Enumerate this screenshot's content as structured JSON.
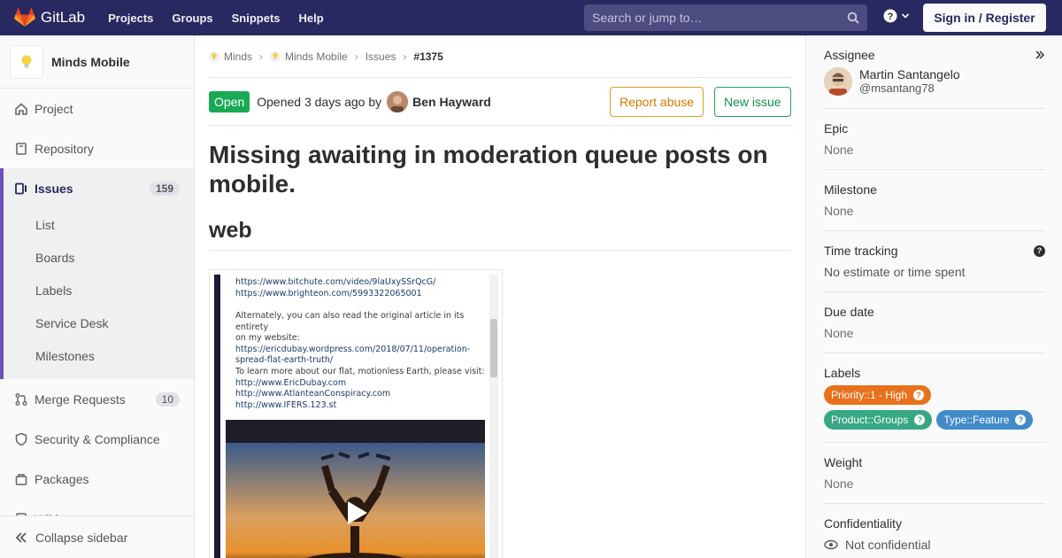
{
  "navbar": {
    "brand": "GitLab",
    "links": [
      "Projects",
      "Groups",
      "Snippets",
      "Help"
    ],
    "search_placeholder": "Search or jump to…",
    "signin": "Sign in / Register",
    "colors": {
      "bar": "#292961",
      "logo": "#fc6d26"
    }
  },
  "sidebar": {
    "project_name": "Minds Mobile",
    "items": {
      "project": "Project",
      "repository": "Repository",
      "issues": "Issues",
      "issues_count": "159",
      "merge_requests": "Merge Requests",
      "merge_requests_count": "10",
      "security": "Security & Compliance",
      "packages": "Packages",
      "wiki": "Wiki"
    },
    "sub_items": [
      "List",
      "Boards",
      "Labels",
      "Service Desk",
      "Milestones"
    ],
    "collapse": "Collapse sidebar"
  },
  "breadcrumb": [
    "Minds",
    "Minds Mobile",
    "Issues",
    "#1375"
  ],
  "issue": {
    "status": "Open",
    "opened_text": "Opened 3 days ago by",
    "author": "Ben Hayward",
    "report_abuse": "Report abuse",
    "new_issue": "New issue",
    "title": "Missing awaiting in moderation queue posts on mobile.",
    "heading": "web"
  },
  "screenshot_text": {
    "lines_top": [
      "https://www.bitchute.com/video/9laUxySSrQcG/",
      "https://www.brighteon.com/5993322065001"
    ],
    "lines_mid": [
      "Alternately, you can also read the original article in its entirety",
      "on my website:",
      "https://ericdubay.wordpress.com/2018/07/11/operation-",
      "spread-flat-earth-truth/"
    ],
    "lines_bottom": [
      "To learn more about our flat, motionless Earth, please visit:",
      "http://www.EricDubay.com",
      "http://www.AtlanteanConspiracy.com",
      "http://www.IFERS.123.st"
    ]
  },
  "right_sidebar": {
    "assignee_title": "Assignee",
    "assignee_name": "Martin Santangelo",
    "assignee_user": "@msantang78",
    "epic_title": "Epic",
    "epic_value": "None",
    "milestone_title": "Milestone",
    "milestone_value": "None",
    "time_title": "Time tracking",
    "time_value": "No estimate or time spent",
    "due_title": "Due date",
    "due_value": "None",
    "labels_title": "Labels",
    "labels": [
      {
        "text": "Priority::1 - High",
        "color": "#e8711c"
      },
      {
        "text": "Product::Groups",
        "color": "#37a883"
      },
      {
        "text": "Type::Feature",
        "color": "#428bca"
      }
    ],
    "weight_title": "Weight",
    "weight_value": "None",
    "confidentiality_title": "Confidentiality",
    "confidentiality_value": "Not confidential"
  }
}
